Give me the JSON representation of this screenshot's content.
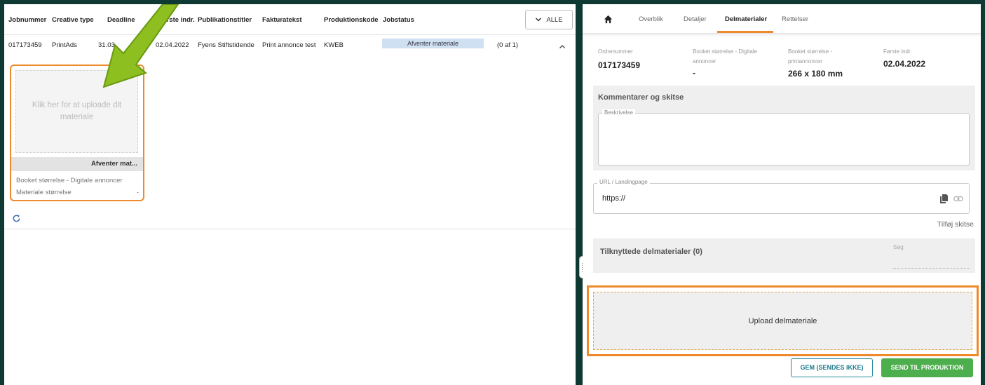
{
  "jobs_table": {
    "columns": [
      "Jobnummer",
      "Creative type",
      "Deadline",
      "Første indr.",
      "Publikationstitler",
      "Fakturatekst",
      "Produktionskode",
      "Jobstatus"
    ],
    "filter_label": "ALLE",
    "row": {
      "jobnummer": "017173459",
      "creative_type": "PrintAds",
      "deadline": "31.03",
      "forste_indr": "02.04.2022",
      "publikationstitler": "Fyens Stiftstidende",
      "fakturatekst": "Print annonce test",
      "produktionskode": "KWEB",
      "jobstatus": "Afventer materiale",
      "count": "(0 af 1)"
    }
  },
  "material_card": {
    "upload_text": "Klik her for at uploade dit materiale",
    "status": "Afventer mat...",
    "line1_label": "Booket størrelse - Digitale annoncer",
    "line2_label": "Materiale størrelse",
    "line2_value": "-"
  },
  "tabs": [
    "Overblik",
    "Detaljer",
    "Delmaterialer",
    "Rettelser"
  ],
  "active_tab": "Delmaterialer",
  "order_info": {
    "ordrenummer_label": "Ordrenummer",
    "ordrenummer_value": "017173459",
    "digital_label_1": "Booket størrelse - Digitale",
    "digital_label_2": "annoncer",
    "digital_value": "-",
    "print_label_1": "Booket størrelse -",
    "print_label_2": "printannoncer",
    "print_value": "266 x 180 mm",
    "forste_label": "Første indr.",
    "forste_value": "02.04.2022"
  },
  "comments": {
    "title": "Kommentarer og skitse",
    "description_label": "Beskrivelse",
    "description_value": ""
  },
  "url_field": {
    "label": "URL / Landingpage",
    "value": "https://"
  },
  "add_sketch_label": "Tilføj skitse",
  "attached": {
    "title": "Tilknyttede delmaterialer (0)",
    "search_label": "Søg"
  },
  "upload_label": "Upload delmateriale",
  "buttons": {
    "save": "GEM (SENDES IKKE)",
    "send": "SEND TIL PRODUKTION"
  },
  "colors": {
    "highlight": "#ee8a2b",
    "status_pill": "#cfe0f3",
    "send_button": "#4cae4c",
    "save_button": "#1a7a8c",
    "background": "#0f3a33",
    "arrow": "#8cbf1f"
  }
}
